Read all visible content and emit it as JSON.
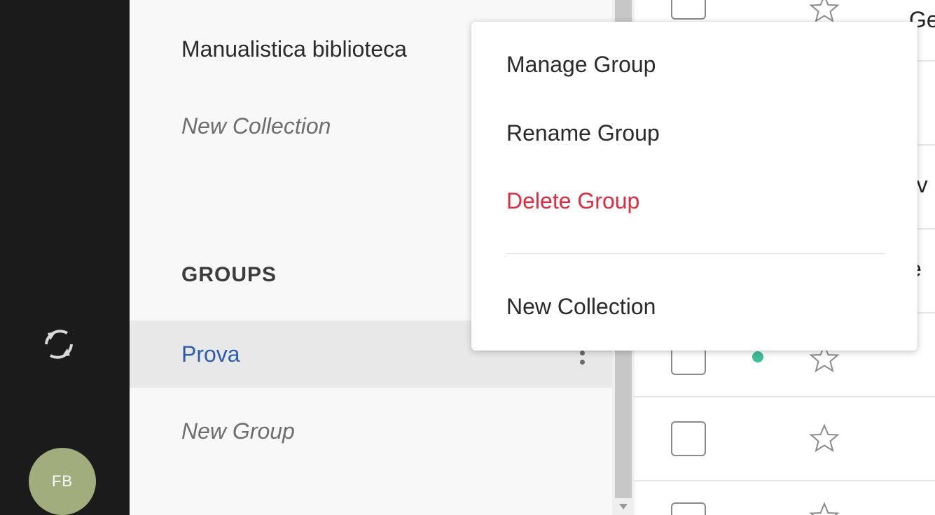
{
  "rail": {
    "sync_icon": "sync-icon",
    "avatar_initials": "FB",
    "avatar_color": "#a1ad7d"
  },
  "sidebar": {
    "collections": [
      {
        "label": "Manualistica biblioteca"
      },
      {
        "label": "New Collection"
      }
    ],
    "groups_heading": "GROUPS",
    "groups": [
      {
        "label": "Prova",
        "selected": true,
        "more_icon": "kebab-icon"
      },
      {
        "label": "New Group"
      }
    ]
  },
  "list": {
    "rows": [
      {
        "text": "Getz",
        "starred": false
      },
      {
        "text": "",
        "starred": false
      },
      {
        "text": "rv",
        "starred": false
      },
      {
        "text": "e",
        "starred": false
      },
      {
        "text": "",
        "starred": false,
        "status_dot": "#3dbd9a"
      },
      {
        "text": "",
        "starred": false
      },
      {
        "text": "",
        "starred": false
      }
    ]
  },
  "context_menu": {
    "items": [
      {
        "label": "Manage Group"
      },
      {
        "label": "Rename Group"
      },
      {
        "label": "Delete Group",
        "danger": true
      }
    ],
    "after_separator": {
      "label": "New Collection"
    }
  },
  "colors": {
    "rail_bg": "#1b1b1b",
    "selected_text": "#2a5db0",
    "danger": "#e5293e",
    "status_dot": "#3dbd9a"
  }
}
